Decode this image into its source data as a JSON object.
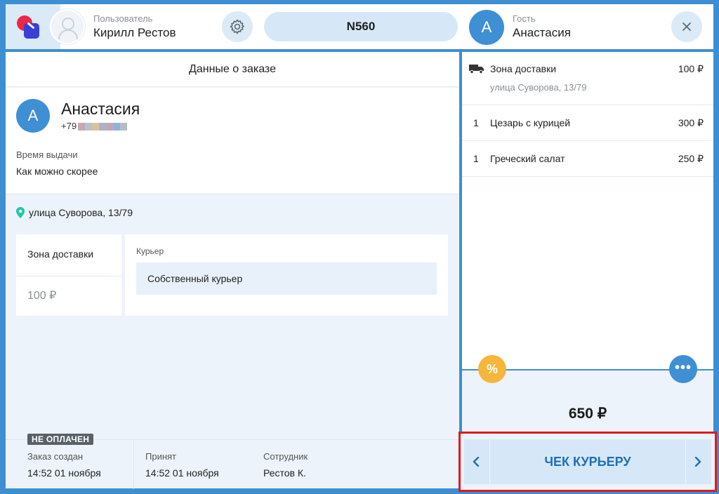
{
  "header": {
    "user_role": "Пользователь",
    "user_name": "Кирилл Рестов",
    "order_number": "N560",
    "guest_initial": "А",
    "guest_role": "Гость",
    "guest_name": "Анастасия"
  },
  "order": {
    "title": "Данные о заказе",
    "client_initial": "А",
    "client_name": "Анастасия",
    "client_phone_prefix": "+79",
    "time_label": "Время выдачи",
    "time_value": "Как можно скорее",
    "address": "улица Суворова, 13/79",
    "zone_title": "Зона доставки",
    "zone_price": "100 ₽",
    "courier_label": "Курьер",
    "courier_value": "Собственный курьер",
    "payment_status": "НЕ ОПЛАЧЕН",
    "created_label": "Заказ создан",
    "created_value": "14:52 01 ноября",
    "accepted_label": "Принят",
    "accepted_value": "14:52 01 ноября",
    "employee_label": "Сотрудник",
    "employee_value": "Рестов К."
  },
  "cart": {
    "delivery": {
      "name": "Зона доставки",
      "price": "100 ₽",
      "address": "улица Суворова, 13/79"
    },
    "items": [
      {
        "qty": "1",
        "name": "Цезарь с курицей",
        "price": "300 ₽"
      },
      {
        "qty": "1",
        "name": "Греческий салат",
        "price": "250 ₽"
      }
    ],
    "discount_symbol": "%",
    "more_symbol": "•••",
    "total": "650 ₽"
  },
  "actions": {
    "check_courier": "ЧЕК КУРЬЕРУ"
  },
  "colors": {
    "accent_blue": "#3f8fd4",
    "highlight_red": "#e01a1a",
    "discount_orange": "#f6b63a"
  },
  "icons": [
    "logo-icon",
    "user-avatar-icon",
    "gear-icon",
    "close-icon",
    "location-pin-icon",
    "truck-icon",
    "percent-icon",
    "more-icon",
    "chevron-left-icon",
    "chevron-right-icon"
  ]
}
